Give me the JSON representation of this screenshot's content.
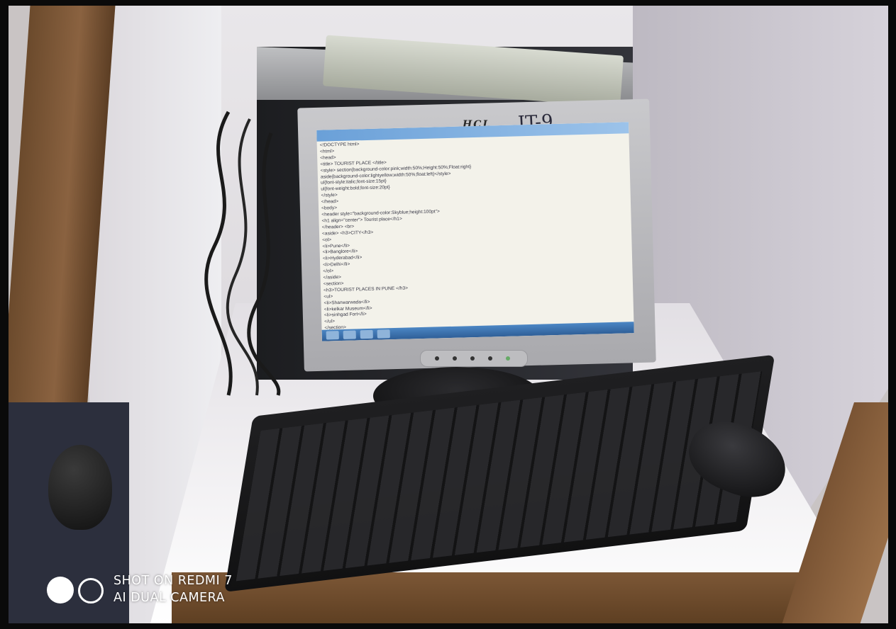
{
  "photo": {
    "monitor_brand": "HCL",
    "handwritten_label": "IT-9",
    "screen_code_lines": [
      "<!DOCTYPE html>",
      "<html>",
      "<head>",
      "<title> TOURIST PLACE </title>",
      "<style> section{background-color:pink;width:50%;Height:50%;Float:right}",
      "aside{background-color:lightyellow;width:50%;float:left}</style>",
      "ul{font-style:italic;font-size:15pt}",
      "ul{font-weight:bold;font-size:20pt}",
      "</style>",
      "</head>",
      "<body>",
      "<header style=\"background-color:Skyblue;height:100pt\">",
      "<h1 align=\"center\"> Tourist place</h1>",
      "</header> <br>",
      "<aside> <h3>CITY</h3>",
      "<ol>",
      "<li>Pune</li>",
      "<li>Banglore</li>",
      "<li>Hyderabad</li>",
      "<li>Delhi</li>",
      "</ol>",
      "</aside>",
      "<section>",
      "<h3>TOURIST PLACES IN PUNE </h3>",
      "<ul>",
      "<li>Shanwarwada</li>",
      "<li>kelkar Museum</li>",
      "<li>sinhgad Fort</li>",
      "</ul>",
      "</section>"
    ]
  },
  "watermark": {
    "line1": "SHOT ON REDMI 7",
    "line2": "AI DUAL CAMERA"
  },
  "colors": {
    "screen_background": "#f3f2ea",
    "taskbar": "#3a6fae",
    "wood": "#7a5434"
  }
}
